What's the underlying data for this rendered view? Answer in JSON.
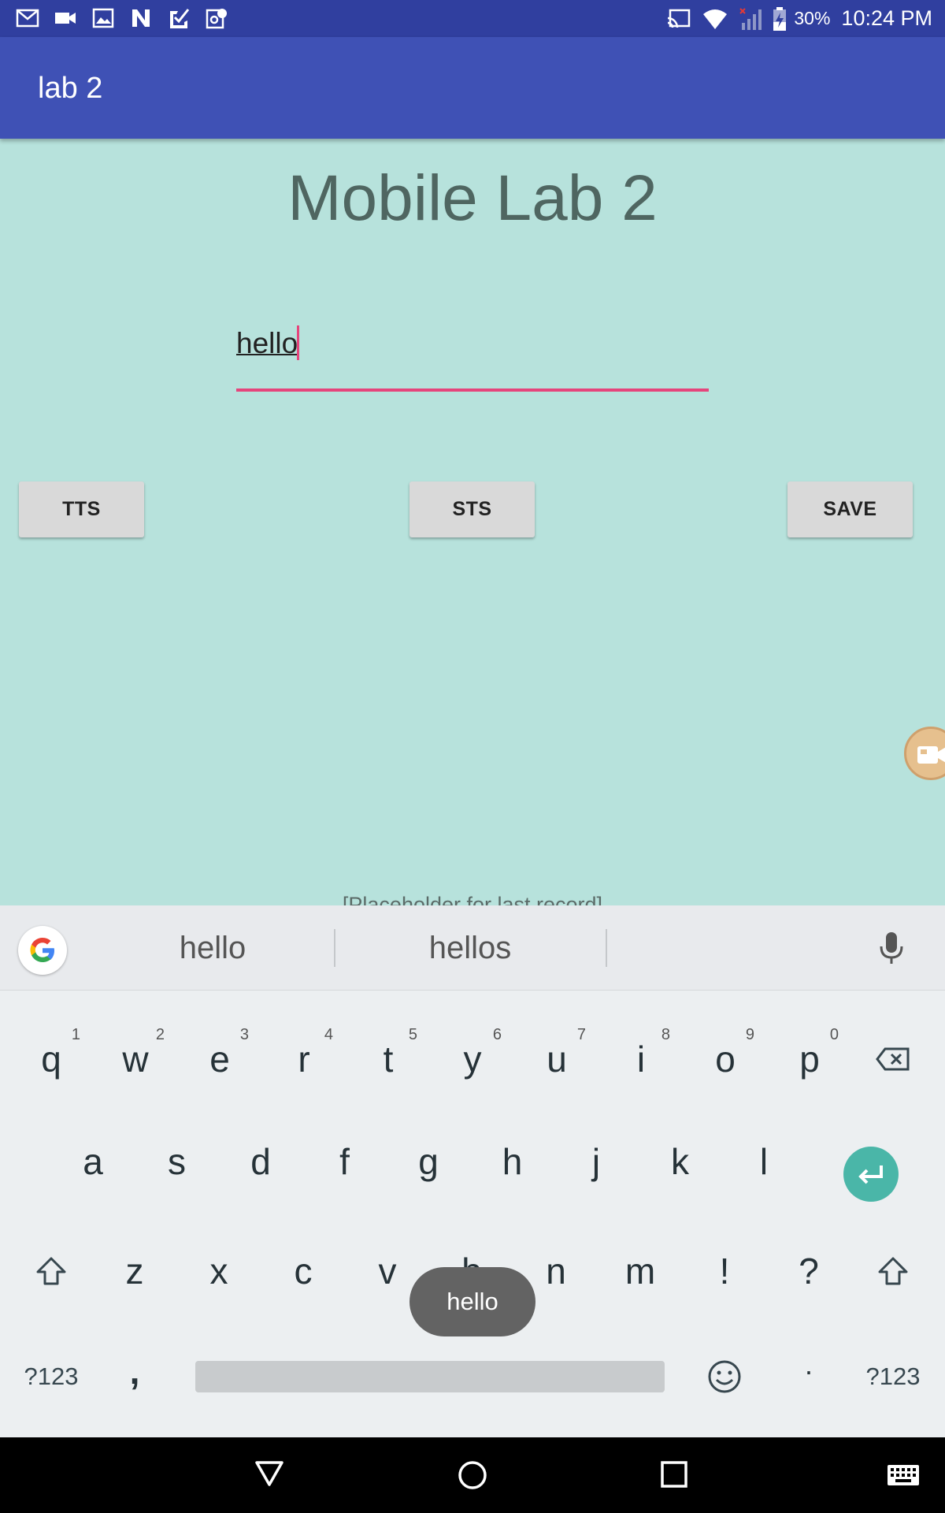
{
  "status_bar": {
    "battery_percent": "30%",
    "time": "10:24 PM",
    "left_icons": [
      "gmail-icon",
      "video-icon",
      "image-icon",
      "n-icon",
      "check-icon",
      "maps-icon"
    ],
    "right_icons": [
      "cast-icon",
      "wifi-icon",
      "signal-icon",
      "battery-charging-icon"
    ]
  },
  "app_bar": {
    "title": "lab 2"
  },
  "main": {
    "heading": "Mobile Lab 2",
    "input_value": "hello",
    "buttons": {
      "tts": "TTS",
      "sts": "STS",
      "save": "SAVE"
    },
    "last_record": "[Placeholder for last record]",
    "fab_icon": "video-camera-icon"
  },
  "keyboard": {
    "suggestions": [
      "hello",
      "hellos"
    ],
    "row1": [
      {
        "k": "q",
        "h": "1"
      },
      {
        "k": "w",
        "h": "2"
      },
      {
        "k": "e",
        "h": "3"
      },
      {
        "k": "r",
        "h": "4"
      },
      {
        "k": "t",
        "h": "5"
      },
      {
        "k": "y",
        "h": "6"
      },
      {
        "k": "u",
        "h": "7"
      },
      {
        "k": "i",
        "h": "8"
      },
      {
        "k": "o",
        "h": "9"
      },
      {
        "k": "p",
        "h": "0"
      }
    ],
    "row2": [
      "a",
      "s",
      "d",
      "f",
      "g",
      "h",
      "j",
      "k",
      "l"
    ],
    "row3": [
      "z",
      "x",
      "c",
      "v",
      "b",
      "n",
      "m",
      "!",
      "?"
    ],
    "symbols_label": "?123",
    "comma": ",",
    "period": "·",
    "toast": "hello",
    "accent_color": "#4ab6a8"
  },
  "colors": {
    "status_bar": "#303f9f",
    "app_bar": "#3f51b5",
    "background": "#b7e2dc",
    "input_accent": "#e5457c"
  }
}
